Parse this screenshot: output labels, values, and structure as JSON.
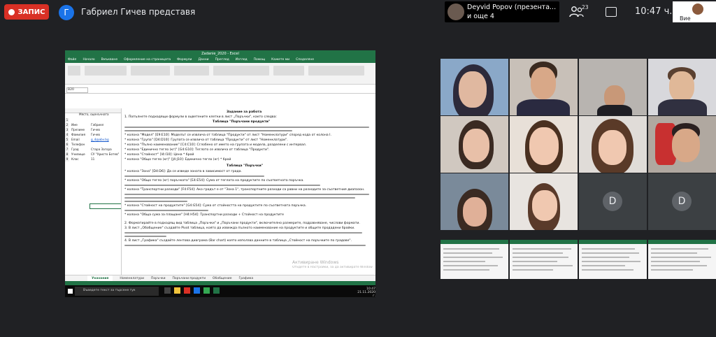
{
  "meet": {
    "recording_label": "ЗАПИС",
    "presenter_initial": "Г",
    "presenter_text": "Габриел Гичев представя",
    "pinned_name": "Deyvid Popov (презента...",
    "pinned_more": "и още 4",
    "people_count": "23",
    "clock": "10:47 ч.",
    "self_label": "Вие",
    "participants": [
      {
        "initial": "D"
      },
      {
        "initial": "D"
      }
    ]
  },
  "excel": {
    "title": "Zadanie_2020 - Excel",
    "tabs": [
      "Файл",
      "Начало",
      "Вмъкване",
      "Оформление на страницата",
      "Формули",
      "Данни",
      "Преглед",
      "Изглед",
      "Помощ",
      "Кажете ми",
      "Споделяне"
    ],
    "name_box": "B20",
    "left_header": "Място, оценъчната",
    "left_rows": [
      {
        "n": "1",
        "k": "",
        "v": ""
      },
      {
        "n": "2",
        "k": "Име",
        "v": "Габриел"
      },
      {
        "n": "3",
        "k": "Презиме",
        "v": "Гичев"
      },
      {
        "n": "4",
        "k": "Фамилия",
        "v": "Гичев"
      },
      {
        "n": "5",
        "k": "Email",
        "v": "g_4@abv.bg"
      },
      {
        "n": "6",
        "k": "Телефон",
        "v": ""
      },
      {
        "n": "7",
        "k": "Град",
        "v": "Стара Загора"
      },
      {
        "n": "8",
        "k": "Училище",
        "v": "СУ \"Христо Ботев\""
      },
      {
        "n": "9",
        "k": "Клас",
        "v": "11"
      }
    ],
    "doc_title": "Задание за работа",
    "doc_intro": "1. Попълнете подходящи формули в оцветените клетки в лист „Поръчки\", както следва:",
    "doc_sub1": "Таблица \"Поръчани продукти\"",
    "doc_sub2": "Таблица \"Поръчки\"",
    "doc_lines": [
      "* колона \"Модел\" [E9:E10]: Моделът се извлича от таблица \"Продукти\" от лист \"Номенклатури\" според кода от колона I.",
      "* колона \"Група\" [D4:D10]: Групата се извлича от таблица \"Продукти\" от лист \"Номенклатури\".",
      "* колона \"Пълно наименование\" [C4:C10]: Сглобено от името на групата и модела, разделени с интервал.",
      "* колона \"Единично тегло (кг)\" [G4:G10]: Теглото се извлича от таблица \"Продукти\".",
      "* колона \"Стойност\" [I4:I10]: Цена * брой",
      "* колона \"Общо тегло (кг)\" [J4:J10]: Единично тегло (кг) * брой",
      "* колона \"Зона\" [D4:D6]: Да се изведе зоната в зависимост от града.",
      "* колона \"Общо тегло (кг) поръчката\" [E4:E54]: Сума от теглата на продуктите по съответната поръчка.",
      "* колона \"Транспортни разходи\" [F4:F54]: Ако градът е от \"Зона 1\", транспортните разходи са равни на разходите за съответния диапазон.",
      "* колона \"Стойност на продуктите\" [G4:G54]: Сума от стойността на продуктите по съответната поръчка.",
      "* колона \"Обща сума за плащане\" [H4:H54]: Транспортни разходи + Стойност на продуктите",
      "2. Форматирайте в подходящ вид таблица „Поръчки\" и „Поръчани продукти\", включително размерите, подравняване, числови формати.",
      "3. В лист „Обобщение\" създайте Pivot таблица, която да извежда пълното наименование на продуктите и общите продадени бройки.",
      "4. В лист „Графика\" създайте лентова диаграма (Bar chart) която използва данните в таблица „Стойност на поръчките по градове\"."
    ],
    "sheet_tabs": [
      "Указания",
      "Номенклатури",
      "Поръчки",
      "Поръчани продукти",
      "Обобщение",
      "Графика"
    ],
    "active_sheet": "Указания",
    "watermark_line1": "Активиране Windows",
    "watermark_line2": "Отидете в Настройки, за да активирате Windows.",
    "search_placeholder": "Въведете текст за търсене тук",
    "tb_time": "10:47",
    "tb_date": "21.11.2020 г."
  },
  "colors": {
    "meet_bg": "#202124",
    "recording": "#d93025",
    "excel_green": "#217346",
    "avatar_blue": "#1a73e8"
  }
}
